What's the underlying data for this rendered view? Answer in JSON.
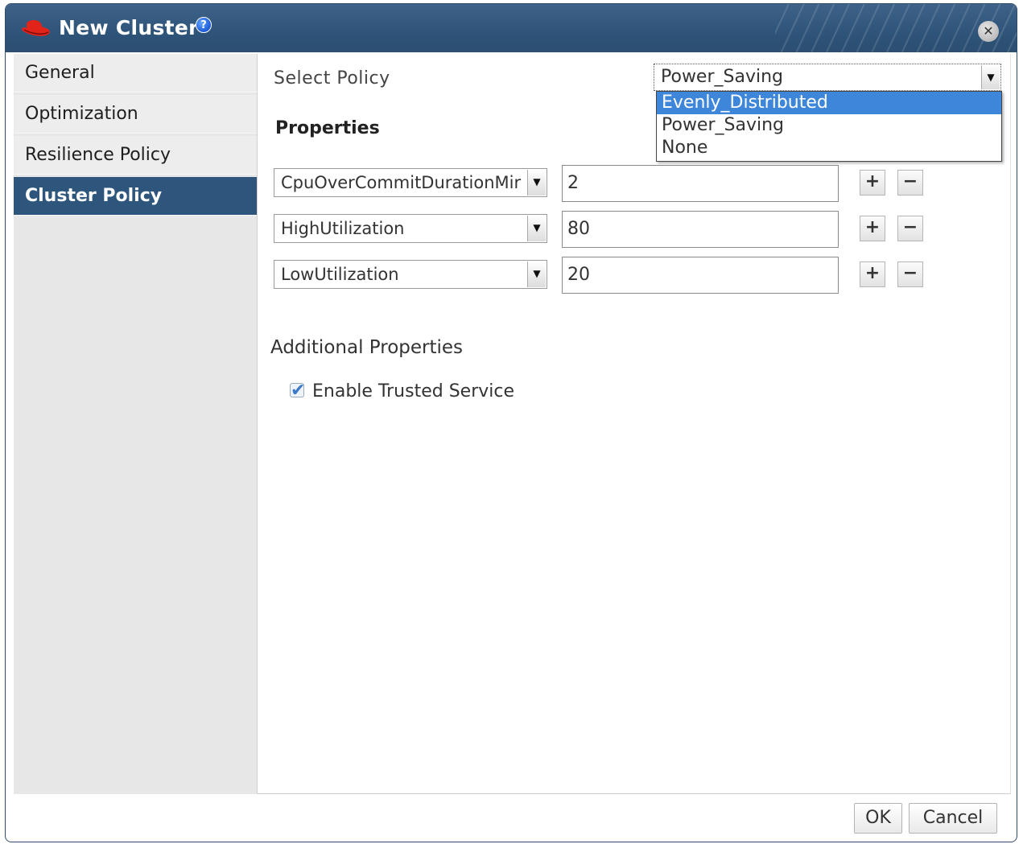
{
  "dialog": {
    "title": "New Cluster",
    "help_icon": "question-mark-icon",
    "close_icon": "close-icon"
  },
  "sidebar": {
    "items": [
      {
        "label": "General",
        "active": false
      },
      {
        "label": "Optimization",
        "active": false
      },
      {
        "label": "Resilience Policy",
        "active": false
      },
      {
        "label": "Cluster Policy",
        "active": true
      }
    ]
  },
  "policy": {
    "label": "Select Policy",
    "selected": "Power_Saving",
    "options": [
      "Evenly_Distributed",
      "Power_Saving",
      "None"
    ],
    "highlighted_option": "Evenly_Distributed"
  },
  "properties": {
    "title": "Properties",
    "rows": [
      {
        "key": "CpuOverCommitDurationMir",
        "value": "2"
      },
      {
        "key": "HighUtilization",
        "value": "80"
      },
      {
        "key": "LowUtilization",
        "value": "20"
      }
    ],
    "add_label": "+",
    "remove_label": "−"
  },
  "additional": {
    "title": "Additional Properties",
    "trusted_service_label": "Enable Trusted Service",
    "trusted_service_checked": true
  },
  "footer": {
    "ok_label": "OK",
    "cancel_label": "Cancel"
  },
  "colors": {
    "titlebar": "#2f5479",
    "active_tab": "#2e567c",
    "dropdown_highlight": "#3d86d9"
  }
}
